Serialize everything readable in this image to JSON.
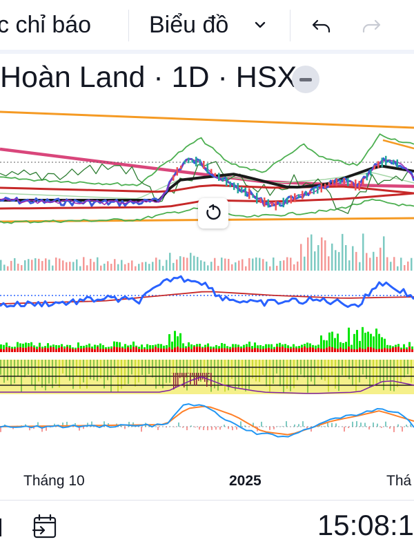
{
  "toolbar": {
    "indicators_label": "c chỉ báo",
    "chart_type_label": "Biểu đồ",
    "undo_icon": "undo-icon",
    "redo_icon": "redo-icon"
  },
  "symbol": {
    "title": "Hoàn Land · 1D · HSX"
  },
  "time_axis": {
    "labels": [
      "Tháng 10",
      "2025",
      "Thá"
    ]
  },
  "bottom_bar": {
    "date_range_icon": "calendar-goto-icon",
    "clock": "15:08:1"
  },
  "colors": {
    "channel": "#f59a23",
    "trend_ma": "#d9467b",
    "bollinger": "#4caf50",
    "price": "#1a1a1a",
    "fast_ma": "#3b5bdb",
    "volume_up": "#26a69a",
    "volume_down": "#ef5350",
    "signal_line": "#2962ff",
    "signal_ma": "#c62828",
    "money_flow_up": "#00e600",
    "money_flow_down": "#e60000",
    "macd": "#2196f3",
    "macd_signal": "#ff7f27"
  }
}
